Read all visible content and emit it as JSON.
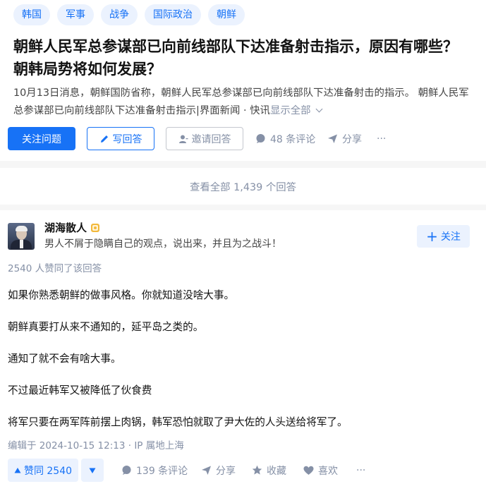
{
  "question": {
    "topics": [
      "韩国",
      "军事",
      "战争",
      "国际政治",
      "朝鲜"
    ],
    "title_line1": "朝鲜人民军总参谋部已向前线部队下达准备射击指示，原因有哪些？",
    "title_line2": "朝韩局势将如何发展？",
    "excerpt_line1": "10月13日消息，朝鲜国防省称，朝鲜人民军总参谋部已向前线部队下达准备射击的指示。 朝鲜人民军",
    "excerpt_line2": "总参谋部已向前线部队下达准备射击指示|界面新闻 · 快讯",
    "show_all": "显示全部",
    "actions": {
      "follow": "关注问题",
      "write": "写回答",
      "invite": "邀请回答",
      "comments": "48 条评论",
      "share": "分享",
      "more": "···"
    }
  },
  "view_all": "查看全部 1,439 个回答",
  "answer": {
    "author_name": "湖海散人",
    "author_bio": "男人不屑于隐瞒自己的观点，说出来，并且为之战斗！",
    "follow_label": "关注",
    "vote_summary": "2540 人赞同了该回答",
    "paragraphs": [
      "如果你熟悉朝鲜的做事风格。你就知道没啥大事。",
      "朝鲜真要打从来不通知的，延平岛之类的。",
      "通知了就不会有啥大事。",
      "不过最近韩军又被降低了伙食费",
      "将军只要在两军阵前摆上肉锅，韩军恐怕就取了尹大佐的人头送给将军了。"
    ],
    "edit_meta": "编辑于 2024-10-15 12:13 · IP 属地上海",
    "actions": {
      "upvote": "赞同 2540",
      "comments": "139 条评论",
      "share": "分享",
      "collect": "收藏",
      "like": "喜欢",
      "more": "···"
    }
  },
  "colors": {
    "accent": "#1772f6",
    "accent_light": "#ebf2fe",
    "muted": "#8590a6",
    "background": "#f6f6f6"
  }
}
